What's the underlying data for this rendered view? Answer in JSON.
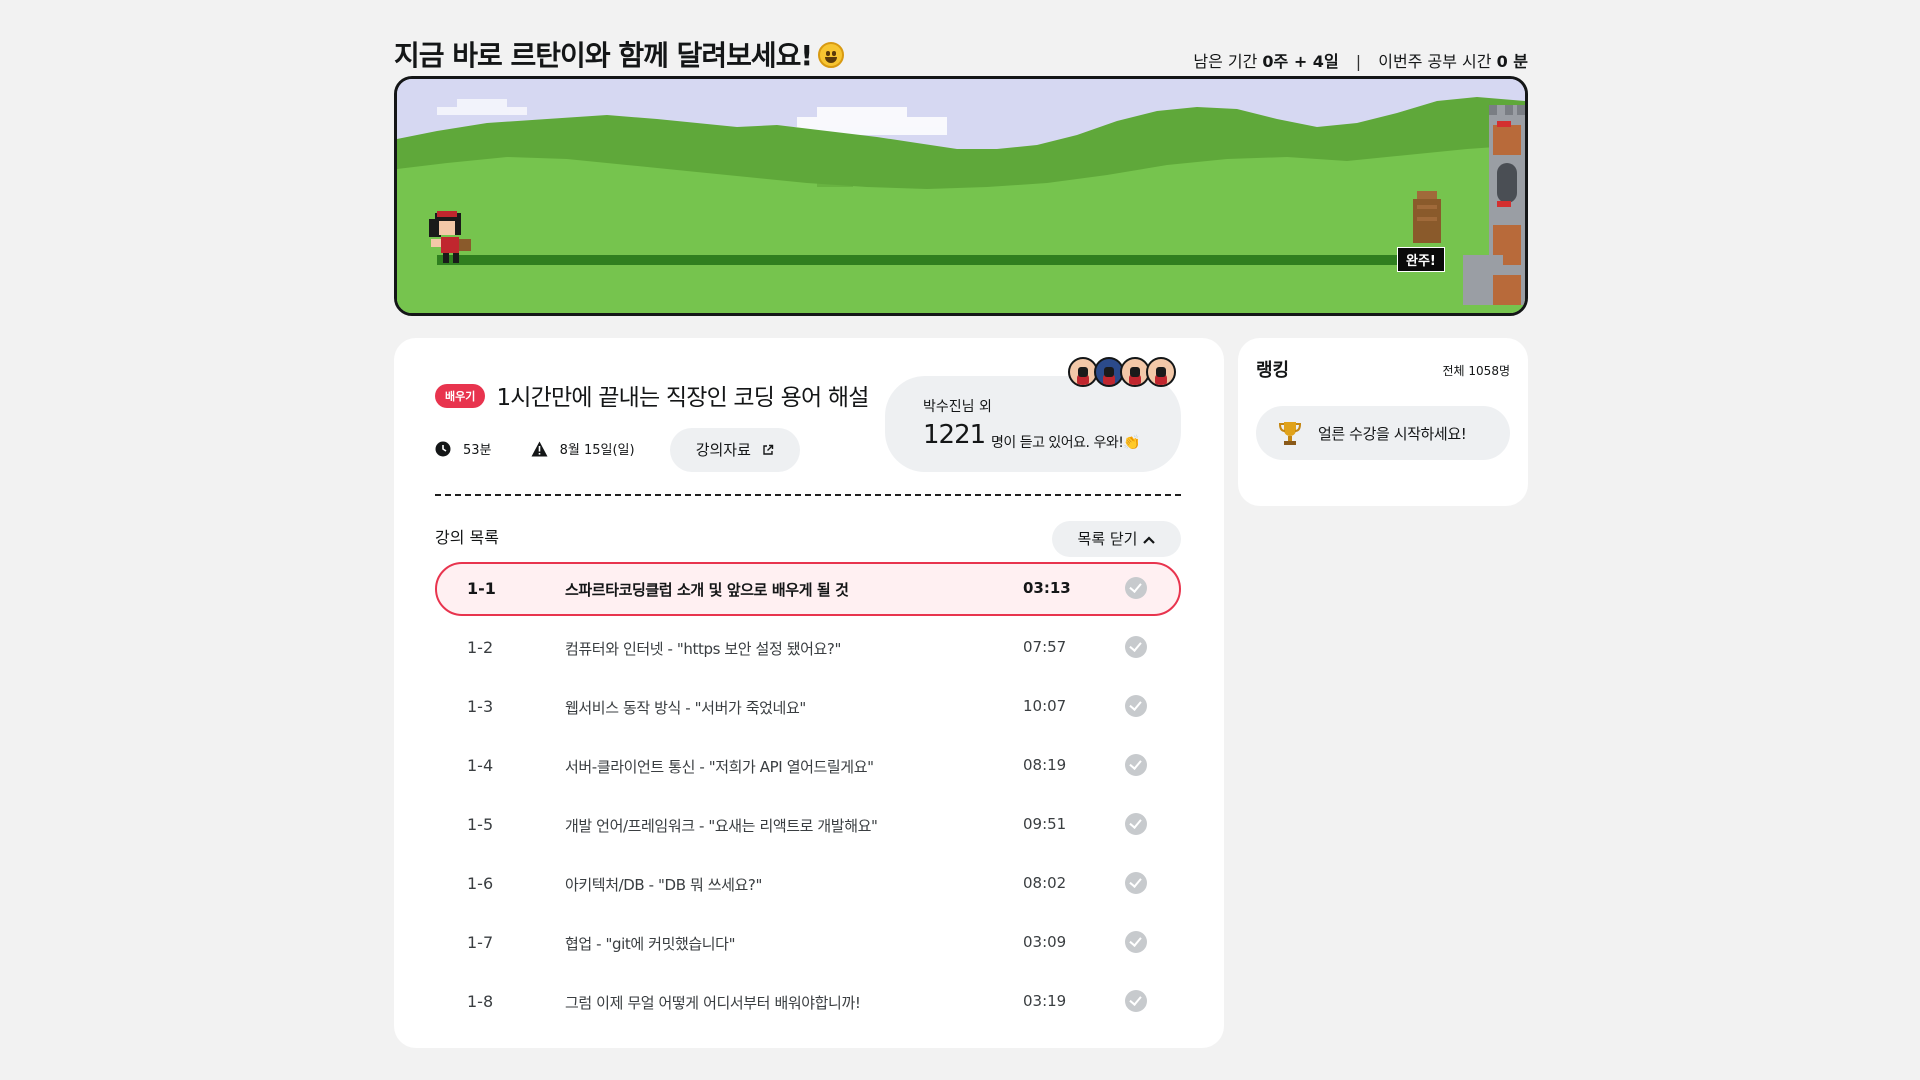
{
  "hero": {
    "title": "지금 바로 르탄이와 함께 달려보세요!",
    "remaining_label": "남은 기간",
    "remaining_value": "0주 + 4일",
    "separator": "|",
    "study_label": "이번주 공부 시간",
    "study_value": "0 분",
    "finish_label": "완주!"
  },
  "course": {
    "badge": "배우기",
    "title": "1시간만에 끝내는 직장인 코딩 용어 해설",
    "duration": "53분",
    "deadline": "8월 15일(일)",
    "material_button": "강의자료",
    "social_name": "박수진님 외",
    "social_count": "1221",
    "social_tail": "명이 듣고 있어요. 우와!",
    "list_title": "강의 목록",
    "collapse_button": "목록 닫기"
  },
  "lectures": [
    {
      "no": "1-1",
      "title": "스파르타코딩클럽 소개 및 앞으로 배우게 될 것",
      "time": "03:13",
      "active": true
    },
    {
      "no": "1-2",
      "title": "컴퓨터와 인터넷 - \"https 보안 설정 됐어요?\"",
      "time": "07:57",
      "active": false
    },
    {
      "no": "1-3",
      "title": "웹서비스 동작 방식 - \"서버가 죽었네요\"",
      "time": "10:07",
      "active": false
    },
    {
      "no": "1-4",
      "title": "서버-클라이언트 통신 - \"저희가 API 열어드릴게요\"",
      "time": "08:19",
      "active": false
    },
    {
      "no": "1-5",
      "title": "개발 언어/프레임워크 - \"요새는 리액트로 개발해요\"",
      "time": "09:51",
      "active": false
    },
    {
      "no": "1-6",
      "title": "아키텍처/DB - \"DB 뭐 쓰세요?\"",
      "time": "08:02",
      "active": false
    },
    {
      "no": "1-7",
      "title": "협업 - \"git에 커밋했습니다\"",
      "time": "03:09",
      "active": false
    },
    {
      "no": "1-8",
      "title": "그럼 이제 무얼 어떻게 어디서부터 배워야합니까!",
      "time": "03:19",
      "active": false
    }
  ],
  "ranking": {
    "title": "랭킹",
    "total": "전체 1058명",
    "cta": "얼른 수강을 시작하세요!"
  },
  "colors": {
    "accent": "#e8344e",
    "active_row_bg": "#fff0f2",
    "chip_bg": "#eef0f2",
    "page_bg": "#f2f2f2",
    "grass": "#76c44e",
    "grass_dark": "#5fa83a",
    "track": "#2f7f1f",
    "sky": "#d6d8f2",
    "check": "#c7cacd"
  },
  "icons": {
    "clock": "clock-icon",
    "warning": "warning-icon",
    "external": "external-link-icon",
    "chevron": "chevron-up-icon",
    "check": "check-circle-icon",
    "trophy": "trophy-icon",
    "emoji": "grinning-face-icon",
    "clap": "clapping-hands-icon"
  }
}
